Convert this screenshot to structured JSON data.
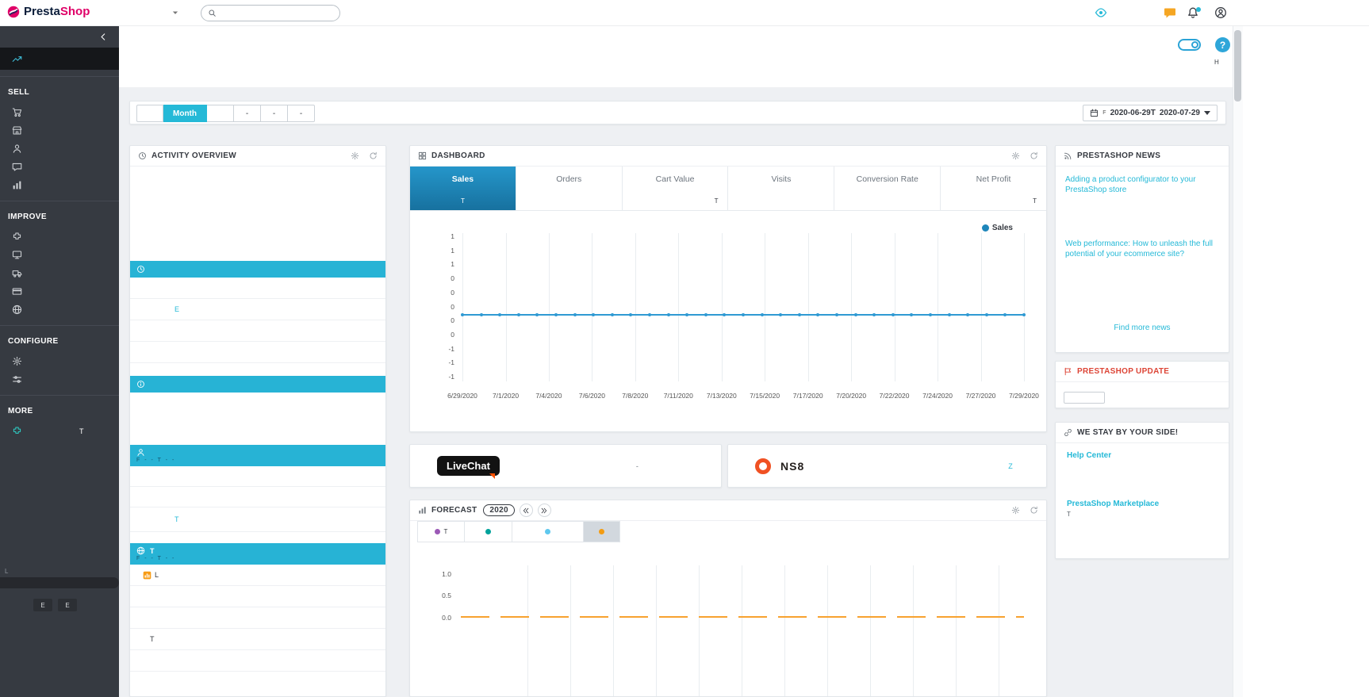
{
  "brand": {
    "first": "Presta",
    "second": "Shop"
  },
  "header": {
    "search_placeholder": "",
    "help_label": "H"
  },
  "sidebar": {
    "sections": [
      {
        "label": "SELL",
        "items": [
          {
            "icon": "cart",
            "label": ""
          },
          {
            "icon": "store",
            "label": ""
          },
          {
            "icon": "customer",
            "label": ""
          },
          {
            "icon": "message",
            "label": ""
          },
          {
            "icon": "stats",
            "label": ""
          }
        ]
      },
      {
        "label": "IMPROVE",
        "items": [
          {
            "icon": "puzzle",
            "label": ""
          },
          {
            "icon": "monitor",
            "label": ""
          },
          {
            "icon": "truck",
            "label": ""
          },
          {
            "icon": "card",
            "label": ""
          },
          {
            "icon": "globe",
            "label": ""
          }
        ]
      },
      {
        "label": "CONFIGURE",
        "items": [
          {
            "icon": "gear",
            "label": ""
          },
          {
            "icon": "sliders",
            "label": ""
          }
        ]
      },
      {
        "label": "MORE",
        "items": [
          {
            "icon": "module",
            "label": "T",
            "color": "#2eccc4"
          }
        ]
      }
    ],
    "footer": {
      "text": "L",
      "buttons": [
        "E",
        "E"
      ]
    }
  },
  "toolbar": {
    "buttons": [
      {
        "label": "",
        "active": false
      },
      {
        "label": "Month",
        "active": true
      },
      {
        "label": "",
        "active": false
      },
      {
        "label": "-",
        "active": false
      },
      {
        "label": "-",
        "active": false
      },
      {
        "label": "-",
        "active": false
      }
    ],
    "date": {
      "prefix": "F",
      "from": "2020-06-29T",
      "to": "2020-07-29"
    }
  },
  "activity": {
    "title": "ACTIVITY OVERVIEW",
    "items": [
      {
        "type": "bar",
        "icon": "clock",
        "title": "",
        "caption": ""
      },
      {
        "type": "row",
        "text": ""
      },
      {
        "type": "row",
        "text": "E",
        "link": true
      },
      {
        "type": "row",
        "text": ""
      },
      {
        "type": "row",
        "text": ""
      },
      {
        "type": "bar",
        "icon": "info",
        "title": "",
        "caption": ""
      },
      {
        "type": "bar",
        "icon": "user",
        "title": "",
        "caption": "F - - T - -"
      },
      {
        "type": "row",
        "text": ""
      },
      {
        "type": "row",
        "text": ""
      },
      {
        "type": "row",
        "text": "T",
        "link": true
      },
      {
        "type": "bar",
        "icon": "globe",
        "title": "T",
        "caption": "F - - T - -"
      },
      {
        "type": "row",
        "text": "L",
        "icon": "analytics"
      },
      {
        "type": "row",
        "text": ""
      },
      {
        "type": "row",
        "text": ""
      },
      {
        "type": "row",
        "text": "T"
      },
      {
        "type": "row",
        "text": ""
      }
    ]
  },
  "dashboard": {
    "title": "DASHBOARD",
    "tabs": [
      {
        "label": "Sales",
        "value": "T",
        "active": true
      },
      {
        "label": "Orders",
        "value": "",
        "active": false
      },
      {
        "label": "Cart Value",
        "value": "T",
        "active": false
      },
      {
        "label": "Visits",
        "value": "",
        "active": false
      },
      {
        "label": "Conversion Rate",
        "value": "",
        "active": false
      },
      {
        "label": "Net Profit",
        "value": "T",
        "active": false
      }
    ],
    "legend": "Sales",
    "chart_data": {
      "type": "line",
      "title": "Sales",
      "x_range": [
        "6/29/2020",
        "7/29/2020"
      ],
      "x_tick_labels": [
        "6/29/2020",
        "7/1/2020",
        "7/4/2020",
        "7/6/2020",
        "7/8/2020",
        "7/11/2020",
        "7/13/2020",
        "7/15/2020",
        "7/17/2020",
        "7/20/2020",
        "7/22/2020",
        "7/24/2020",
        "7/27/2020",
        "7/29/2020"
      ],
      "y_tick_labels": [
        "1",
        "1",
        "1",
        "0",
        "0",
        "0",
        "0",
        "0",
        "-1",
        "-1",
        "-1"
      ],
      "ylim": [
        -1.5,
        1.5
      ],
      "series": [
        {
          "name": "Sales",
          "values": [
            0,
            0,
            0,
            0,
            0,
            0,
            0,
            0,
            0,
            0,
            0,
            0,
            0,
            0,
            0,
            0,
            0,
            0,
            0,
            0,
            0,
            0,
            0,
            0,
            0,
            0,
            0,
            0,
            0,
            0,
            0
          ]
        }
      ],
      "line_color": "#2f9ad3",
      "legend_position": "top-right",
      "grid": "vertical"
    }
  },
  "partners": {
    "livechat": {
      "logo": "LiveChat",
      "note": "-"
    },
    "ns8": {
      "logo": "NS8",
      "note": "Z"
    }
  },
  "forecast": {
    "title": "FORECAST",
    "year": "2020",
    "tabs": [
      {
        "label": "T",
        "color": "#9b59b6",
        "active": false
      },
      {
        "label": "",
        "color": "#00a29b",
        "active": false
      },
      {
        "label": "",
        "color": "#5fc8ee",
        "active": false
      },
      {
        "label": "",
        "color": "#f39c12",
        "active": true
      }
    ],
    "chart_data": {
      "type": "line",
      "y_tick_labels": [
        "1.0",
        "0.5",
        "0.0"
      ],
      "series": [
        {
          "name": "Forecast",
          "values": [
            0,
            0,
            0,
            0,
            0,
            0,
            0,
            0,
            0,
            0,
            0,
            0
          ]
        }
      ],
      "line_color": "#f7a22f",
      "line_style": "dashed",
      "grid": "vertical"
    }
  },
  "news": {
    "title": "PRESTASHOP NEWS",
    "articles": [
      "Adding a product configurator to your PrestaShop store",
      "Web performance: How to unleash the full potential of your ecommerce site?"
    ],
    "more_label": "Find more news"
  },
  "update": {
    "title": "PRESTASHOP UPDATE",
    "button_label": ""
  },
  "support": {
    "title": "WE STAY BY YOUR SIDE!",
    "links": [
      "Help Center",
      "PrestaShop Marketplace"
    ],
    "note": "T"
  }
}
